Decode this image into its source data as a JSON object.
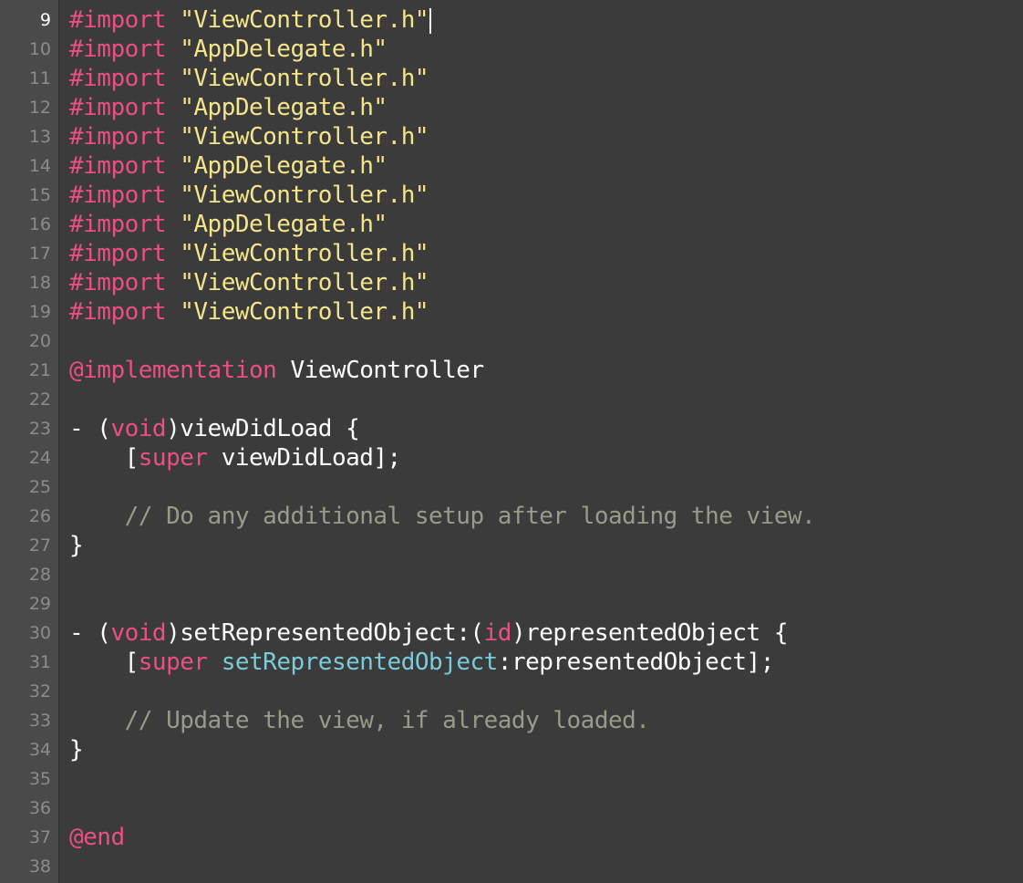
{
  "editor": {
    "current_line": 9,
    "colors": {
      "background": "#3b3b3b",
      "gutter": "#4a4a4a",
      "keyword": "#ec4f84",
      "string": "#f4e58c",
      "method": "#7bcbd8",
      "comment": "#9a9a8a",
      "plain": "#ffffff",
      "line_number": "#8c8c8c"
    },
    "lines": [
      {
        "n": "9",
        "tokens": [
          {
            "t": "kw",
            "v": "#import"
          },
          {
            "t": "plain",
            "v": " "
          },
          {
            "t": "str",
            "v": "\"ViewController.h\""
          }
        ],
        "cursor": true
      },
      {
        "n": "10",
        "tokens": [
          {
            "t": "kw",
            "v": "#import"
          },
          {
            "t": "plain",
            "v": " "
          },
          {
            "t": "str",
            "v": "\"AppDelegate.h\""
          }
        ]
      },
      {
        "n": "11",
        "tokens": [
          {
            "t": "kw",
            "v": "#import"
          },
          {
            "t": "plain",
            "v": " "
          },
          {
            "t": "str",
            "v": "\"ViewController.h\""
          }
        ]
      },
      {
        "n": "12",
        "tokens": [
          {
            "t": "kw",
            "v": "#import"
          },
          {
            "t": "plain",
            "v": " "
          },
          {
            "t": "str",
            "v": "\"AppDelegate.h\""
          }
        ]
      },
      {
        "n": "13",
        "tokens": [
          {
            "t": "kw",
            "v": "#import"
          },
          {
            "t": "plain",
            "v": " "
          },
          {
            "t": "str",
            "v": "\"ViewController.h\""
          }
        ]
      },
      {
        "n": "14",
        "tokens": [
          {
            "t": "kw",
            "v": "#import"
          },
          {
            "t": "plain",
            "v": " "
          },
          {
            "t": "str",
            "v": "\"AppDelegate.h\""
          }
        ]
      },
      {
        "n": "15",
        "tokens": [
          {
            "t": "kw",
            "v": "#import"
          },
          {
            "t": "plain",
            "v": " "
          },
          {
            "t": "str",
            "v": "\"ViewController.h\""
          }
        ]
      },
      {
        "n": "16",
        "tokens": [
          {
            "t": "kw",
            "v": "#import"
          },
          {
            "t": "plain",
            "v": " "
          },
          {
            "t": "str",
            "v": "\"AppDelegate.h\""
          }
        ]
      },
      {
        "n": "17",
        "tokens": [
          {
            "t": "kw",
            "v": "#import"
          },
          {
            "t": "plain",
            "v": " "
          },
          {
            "t": "str",
            "v": "\"ViewController.h\""
          }
        ]
      },
      {
        "n": "18",
        "tokens": [
          {
            "t": "kw",
            "v": "#import"
          },
          {
            "t": "plain",
            "v": " "
          },
          {
            "t": "str",
            "v": "\"ViewController.h\""
          }
        ]
      },
      {
        "n": "19",
        "tokens": [
          {
            "t": "kw",
            "v": "#import"
          },
          {
            "t": "plain",
            "v": " "
          },
          {
            "t": "str",
            "v": "\"ViewController.h\""
          }
        ]
      },
      {
        "n": "20",
        "tokens": []
      },
      {
        "n": "21",
        "tokens": [
          {
            "t": "kw",
            "v": "@implementation"
          },
          {
            "t": "plain",
            "v": " ViewController"
          }
        ]
      },
      {
        "n": "22",
        "tokens": []
      },
      {
        "n": "23",
        "tokens": [
          {
            "t": "plain",
            "v": "- ("
          },
          {
            "t": "kw",
            "v": "void"
          },
          {
            "t": "plain",
            "v": ")viewDidLoad {"
          }
        ]
      },
      {
        "n": "24",
        "tokens": [
          {
            "t": "plain",
            "v": "    ["
          },
          {
            "t": "kw",
            "v": "super"
          },
          {
            "t": "plain",
            "v": " viewDidLoad];"
          }
        ]
      },
      {
        "n": "25",
        "tokens": []
      },
      {
        "n": "26",
        "tokens": [
          {
            "t": "plain",
            "v": "    "
          },
          {
            "t": "com",
            "v": "// Do any additional setup after loading the view."
          }
        ]
      },
      {
        "n": "27",
        "tokens": [
          {
            "t": "plain",
            "v": "}"
          }
        ]
      },
      {
        "n": "28",
        "tokens": []
      },
      {
        "n": "29",
        "tokens": []
      },
      {
        "n": "30",
        "tokens": [
          {
            "t": "plain",
            "v": "- ("
          },
          {
            "t": "kw",
            "v": "void"
          },
          {
            "t": "plain",
            "v": ")setRepresentedObject:("
          },
          {
            "t": "kw",
            "v": "id"
          },
          {
            "t": "plain",
            "v": ")representedObject {"
          }
        ]
      },
      {
        "n": "31",
        "tokens": [
          {
            "t": "plain",
            "v": "    ["
          },
          {
            "t": "kw",
            "v": "super"
          },
          {
            "t": "plain",
            "v": " "
          },
          {
            "t": "fn",
            "v": "setRepresentedObject"
          },
          {
            "t": "plain",
            "v": ":representedObject];"
          }
        ]
      },
      {
        "n": "32",
        "tokens": []
      },
      {
        "n": "33",
        "tokens": [
          {
            "t": "plain",
            "v": "    "
          },
          {
            "t": "com",
            "v": "// Update the view, if already loaded."
          }
        ]
      },
      {
        "n": "34",
        "tokens": [
          {
            "t": "plain",
            "v": "}"
          }
        ]
      },
      {
        "n": "35",
        "tokens": []
      },
      {
        "n": "36",
        "tokens": []
      },
      {
        "n": "37",
        "tokens": [
          {
            "t": "kw",
            "v": "@end"
          }
        ]
      },
      {
        "n": "38",
        "tokens": []
      }
    ]
  }
}
